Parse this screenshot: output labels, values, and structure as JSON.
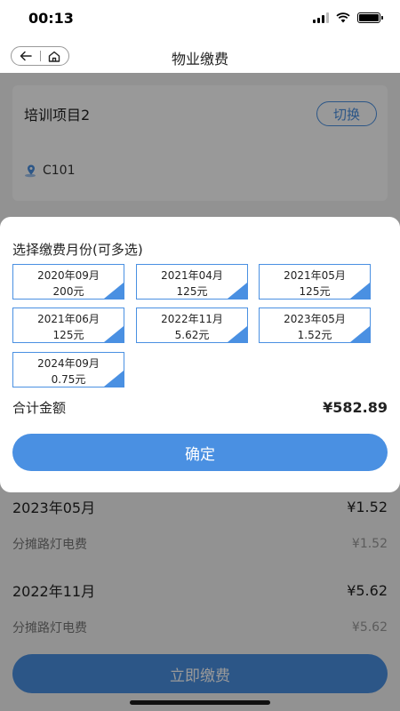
{
  "status_bar": {
    "time": "00:13"
  },
  "nav": {
    "title": "物业缴费"
  },
  "project": {
    "name": "培训项目2",
    "switch_label": "切换",
    "location": "C101"
  },
  "bills": [
    {
      "month": "2023年05月",
      "amount": "¥1.52",
      "item": "分摊路灯电费",
      "item_amount": "¥1.52"
    },
    {
      "month": "2022年11月",
      "amount": "¥5.62",
      "item": "分摊路灯电费",
      "item_amount": "¥5.62"
    }
  ],
  "pay_button": "立即缴费",
  "sheet": {
    "title": "选择缴费月份(可多选)",
    "months": [
      {
        "month": "2020年09月",
        "amount": "200元",
        "selected": true
      },
      {
        "month": "2021年04月",
        "amount": "125元",
        "selected": true
      },
      {
        "month": "2021年05月",
        "amount": "125元",
        "selected": true
      },
      {
        "month": "2021年06月",
        "amount": "125元",
        "selected": true
      },
      {
        "month": "2022年11月",
        "amount": "5.62元",
        "selected": true
      },
      {
        "month": "2023年05月",
        "amount": "1.52元",
        "selected": true
      },
      {
        "month": "2024年09月",
        "amount": "0.75元",
        "selected": true
      }
    ],
    "total_label": "合计金额",
    "total_amount": "¥582.89",
    "confirm_label": "确定"
  },
  "colors": {
    "accent": "#4a90e2",
    "overlay": "rgba(0,0,0,0.4)"
  },
  "icons": [
    "back-arrow-icon",
    "home-icon",
    "location-pin-icon",
    "signal-icon",
    "wifi-icon",
    "battery-icon"
  ]
}
